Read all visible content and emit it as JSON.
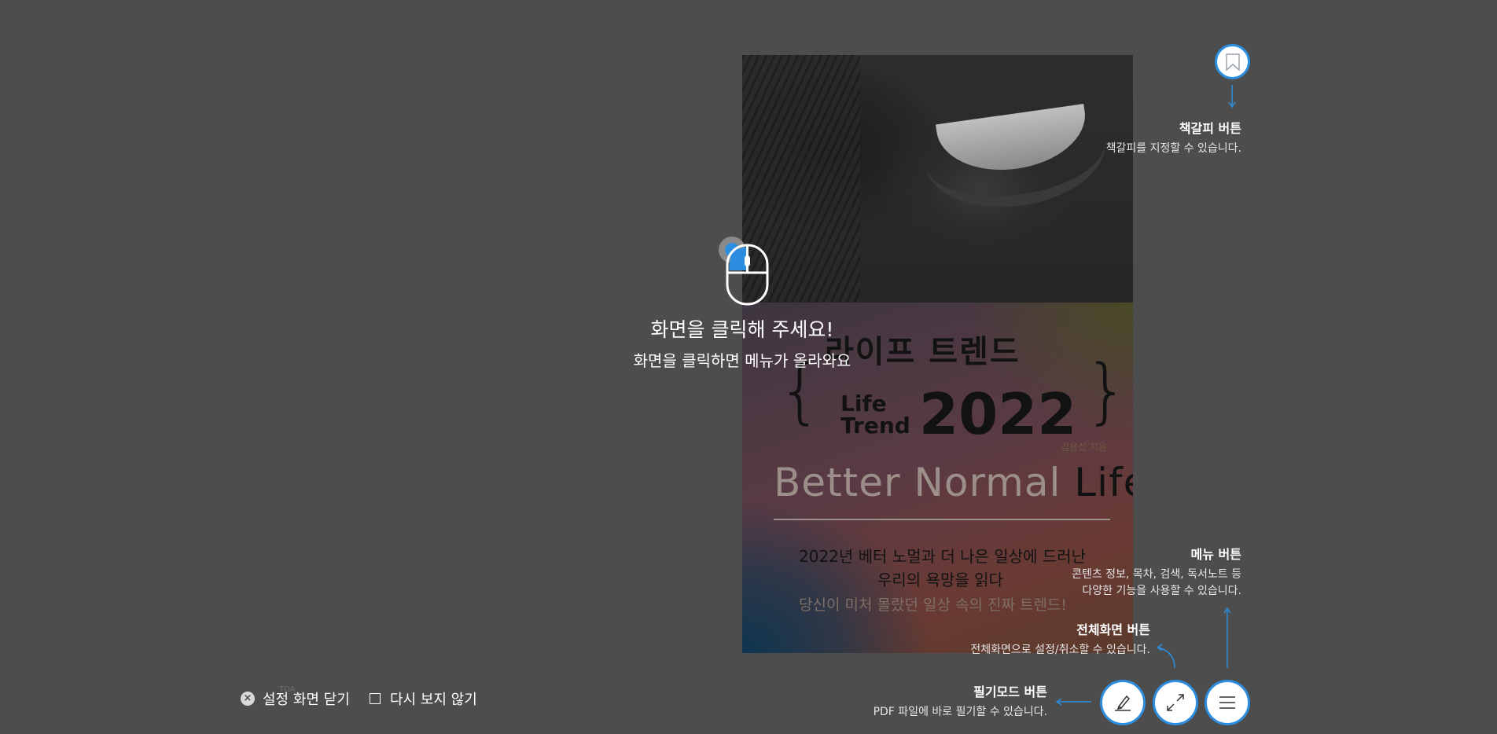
{
  "overlay": {
    "title": "화면을 클릭해 주세요!",
    "subtitle": "화면을 클릭하면 메뉴가 올라와요"
  },
  "book_cover": {
    "title_korean": "라이프 트렌드",
    "title_life": "Life",
    "title_trend": "Trend",
    "year": "2022",
    "small_author": "김용섭 지음",
    "better_normal": "Better Normal ",
    "life": "Life",
    "line1": "2022년 베터 노멀과 더 나은 일상에 드러난",
    "line2": "우리의 욕망을 읽다",
    "line3": "당신이 미처 몰랐던 일상 속의 진짜 트렌드!"
  },
  "bookmark": {
    "title": "책갈피 버튼",
    "desc": "책갈피를 지정할 수 있습니다."
  },
  "menu": {
    "title": "메뉴 버튼",
    "desc1": "콘텐츠 정보, 목차, 검색, 독서노트 등",
    "desc2": "다양한 기능을 사용할 수 있습니다."
  },
  "fullscreen": {
    "title": "전체화면 버튼",
    "desc": "전체화면으로 설정/취소할 수 있습니다."
  },
  "pen": {
    "title": "필기모드 버튼",
    "desc": "PDF 파일에 바로 필기할 수 있습니다."
  },
  "footer": {
    "close_label": "설정 화면 닫기",
    "never_show_label": "다시 보지 않기",
    "faint_text": "TOA",
    "close_icon": "×"
  },
  "colors": {
    "background": "#4d4d4d",
    "accent": "#2d8ee0"
  }
}
